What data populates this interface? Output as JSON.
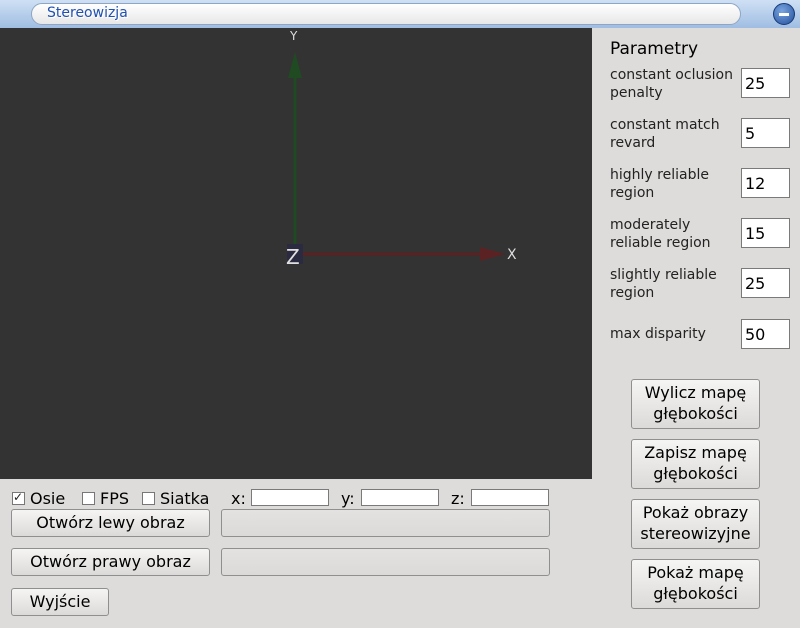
{
  "window": {
    "title": "Stereowizja"
  },
  "viewport": {
    "axes": {
      "x_label": "X",
      "y_label": "Y",
      "z_label": "Z"
    },
    "colors": {
      "background": "#333333",
      "x_axis": "#5a2222",
      "y_axis": "#1f4a22"
    }
  },
  "params": {
    "title": "Parametry",
    "items": [
      {
        "label": "constant oclusion penalty",
        "value": "25"
      },
      {
        "label": "constant match revard",
        "value": "5"
      },
      {
        "label": "highly reliable region",
        "value": "12"
      },
      {
        "label": "moderately reliable region",
        "value": "15"
      },
      {
        "label": "slightly reliable region",
        "value": "25"
      },
      {
        "label": "max disparity",
        "value": "50"
      }
    ]
  },
  "actions": {
    "compute_depth": [
      "Wylicz mapę",
      "głębokości"
    ],
    "save_depth": [
      "Zapisz mapę",
      "głębokości"
    ],
    "show_stereo": [
      "Pokaż obrazy",
      "stereowizyjne"
    ],
    "show_depth": [
      "Pokaż mapę",
      "głębokości"
    ]
  },
  "options": {
    "axes": {
      "label": "Osie",
      "checked": true
    },
    "fps": {
      "label": "FPS",
      "checked": false
    },
    "grid": {
      "label": "Siatka",
      "checked": false
    }
  },
  "coords": {
    "x_label": "x:",
    "y_label": "y:",
    "z_label": "z:"
  },
  "files": {
    "open_left_label": "Otwórz lewy obraz",
    "open_right_label": "Otwórz prawy obraz",
    "exit_label": "Wyjście"
  }
}
